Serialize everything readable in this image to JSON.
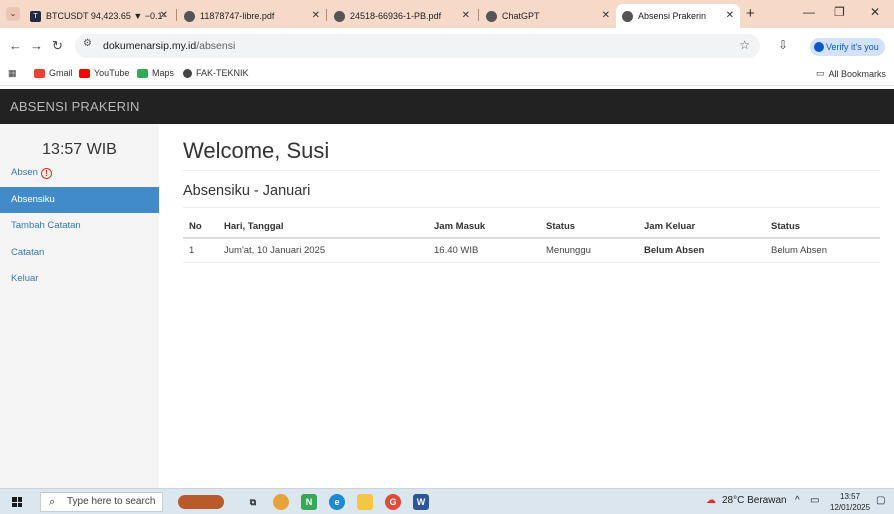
{
  "browser": {
    "tabs": [
      {
        "title": "BTCUSDT 94,423.65 ▼ −0.1·",
        "favicon": "tradingview-icon"
      },
      {
        "title": "11878747-libre.pdf",
        "favicon": "globe-icon"
      },
      {
        "title": "24518-66936-1-PB.pdf",
        "favicon": "globe-icon"
      },
      {
        "title": "ChatGPT",
        "favicon": "chatgpt-icon"
      },
      {
        "title": "Absensi Prakerin",
        "favicon": "globe-icon",
        "active": true
      }
    ],
    "url_host": "dokumenarsip.my.id",
    "url_path": "/absensi",
    "profile_label": "Verify it's you",
    "bookmarks": [
      {
        "label": "Gmail",
        "color": "#ea4335"
      },
      {
        "label": "YouTube",
        "color": "#ff0000"
      },
      {
        "label": "Maps",
        "color": "#34a853"
      },
      {
        "label": "FAK-TEKNIK",
        "color": "#444444"
      }
    ],
    "all_bookmarks_label": "All Bookmarks"
  },
  "site": {
    "brand": "ABSENSI PRAKERIN",
    "clock": "13:57 WIB",
    "sidebar": [
      {
        "label": "Absen",
        "alert": true
      },
      {
        "label": "Absensiku",
        "active": true
      },
      {
        "label": "Tambah Catatan"
      },
      {
        "label": "Catatan"
      },
      {
        "label": "Keluar"
      }
    ],
    "welcome": "Welcome, Susi",
    "section_title": "Absensiku - Januari",
    "table": {
      "headers": [
        "No",
        "Hari, Tanggal",
        "Jam Masuk",
        "Status",
        "Jam Keluar",
        "Status"
      ],
      "rows": [
        [
          "1",
          "Jum'at, 10 Januari 2025",
          "16.40 WIB",
          "Menunggu",
          "Belum Absen",
          "Belum Absen"
        ]
      ]
    },
    "colors": {
      "navbar": "#222222",
      "active_link": "#428bca",
      "link": "#337ab7"
    }
  },
  "taskbar": {
    "search_placeholder": "Type here to search",
    "weather": "28°C Berawan",
    "time": "13:57",
    "date": "12/01/2025"
  }
}
